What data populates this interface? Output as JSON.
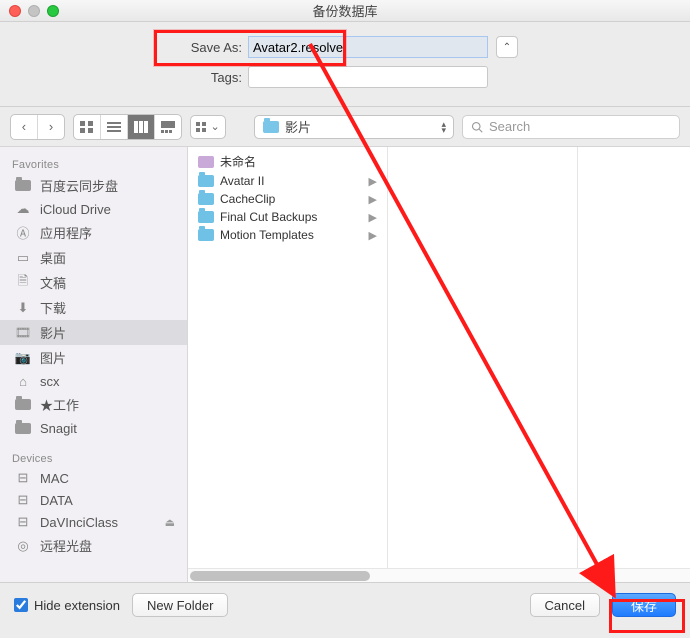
{
  "window": {
    "title": "备份数据库"
  },
  "saveas": {
    "label": "Save As:",
    "filename": "Avatar2.resolve",
    "tags_label": "Tags:",
    "expand_glyph": "⌃"
  },
  "toolbar": {
    "path_label": "影片",
    "search_placeholder": "Search",
    "view_mode_active": "columns"
  },
  "sidebar": {
    "favorites_label": "Favorites",
    "devices_label": "Devices",
    "favorites": [
      {
        "name": "百度云同步盘",
        "icon": "folder"
      },
      {
        "name": "iCloud Drive",
        "icon": "cloud"
      },
      {
        "name": "应用程序",
        "icon": "apps"
      },
      {
        "name": "桌面",
        "icon": "desktop"
      },
      {
        "name": "文稿",
        "icon": "docs"
      },
      {
        "name": "下载",
        "icon": "download"
      },
      {
        "name": "影片",
        "icon": "movies",
        "selected": true
      },
      {
        "name": "图片",
        "icon": "pictures"
      },
      {
        "name": "scx",
        "icon": "home"
      },
      {
        "name": "★工作",
        "icon": "folder"
      },
      {
        "name": "Snagit",
        "icon": "folder"
      }
    ],
    "devices": [
      {
        "name": "MAC",
        "icon": "disk"
      },
      {
        "name": "DATA",
        "icon": "disk"
      },
      {
        "name": "DaVInciClass",
        "icon": "disk",
        "ejectable": true
      },
      {
        "name": "远程光盘",
        "icon": "optical"
      }
    ]
  },
  "file_list": {
    "column1": [
      {
        "name": "未命名",
        "type": "clip"
      },
      {
        "name": "Avatar II",
        "type": "folder",
        "has_children": true
      },
      {
        "name": "CacheClip",
        "type": "folder",
        "has_children": true
      },
      {
        "name": "Final Cut Backups",
        "type": "folder",
        "has_children": true
      },
      {
        "name": "Motion Templates",
        "type": "folder",
        "has_children": true
      }
    ]
  },
  "footer": {
    "hide_ext_label": "Hide extension",
    "hide_ext_checked": true,
    "new_folder_label": "New Folder",
    "cancel_label": "Cancel",
    "save_label": "保存"
  }
}
